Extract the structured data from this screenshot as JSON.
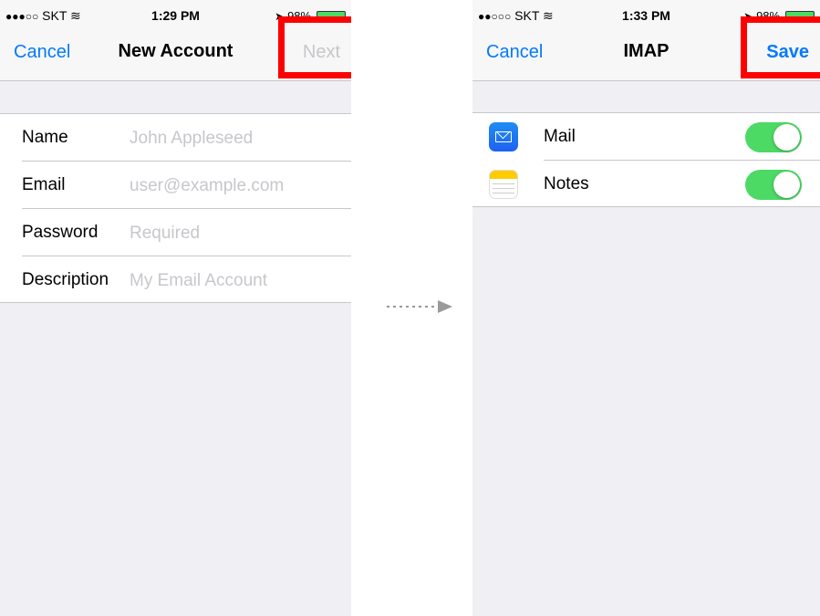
{
  "left_screen": {
    "status": {
      "carrier": "SKT",
      "signal": "●●●○○",
      "time": "1:29 PM",
      "battery": "98%"
    },
    "nav": {
      "cancel": "Cancel",
      "title": "New Account",
      "next": "Next"
    },
    "fields": [
      {
        "label": "Name",
        "placeholder": "John Appleseed"
      },
      {
        "label": "Email",
        "placeholder": "user@example.com"
      },
      {
        "label": "Password",
        "placeholder": "Required"
      },
      {
        "label": "Description",
        "placeholder": "My Email Account"
      }
    ]
  },
  "right_screen": {
    "status": {
      "carrier": "SKT",
      "signal": "●●○○○",
      "time": "1:33 PM",
      "battery": "98%"
    },
    "nav": {
      "cancel": "Cancel",
      "title": "IMAP",
      "save": "Save"
    },
    "items": [
      {
        "label": "Mail",
        "icon": "mail-icon",
        "enabled": true
      },
      {
        "label": "Notes",
        "icon": "notes-icon",
        "enabled": true
      }
    ]
  },
  "colors": {
    "accent": "#007aff",
    "toggle_on": "#4cd964",
    "highlight": "#ff0000",
    "disabled": "#c7c7cc"
  }
}
